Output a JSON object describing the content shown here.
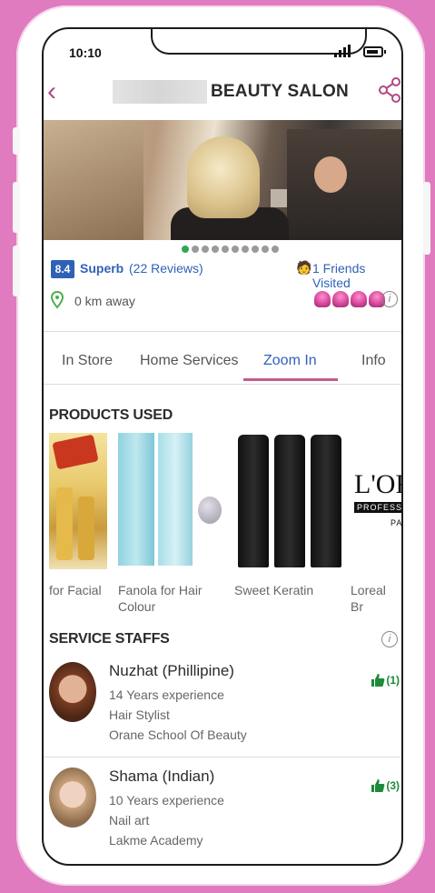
{
  "status_bar": {
    "time": "10:10"
  },
  "header": {
    "title": "BEAUTY SALON"
  },
  "rating": {
    "score": "8.4",
    "label": "Superb",
    "reviews": "(22 Reviews)",
    "friends": "1 Friends Visited"
  },
  "location": {
    "distance": "0 km away",
    "cupcake_rating": 4
  },
  "tabs": [
    {
      "label": "In Store",
      "active": false
    },
    {
      "label": "Home Services",
      "active": false
    },
    {
      "label": "Zoom In",
      "active": true
    },
    {
      "label": "Info",
      "active": false
    }
  ],
  "products_section": {
    "title": "PRODUCTS USED",
    "items": [
      {
        "caption": "for Facial"
      },
      {
        "caption": "Fanola for Hair\nColour"
      },
      {
        "caption": "Sweet Keratin"
      },
      {
        "caption": "Loreal Br"
      }
    ],
    "brand_text": {
      "line1": "L'OR",
      "line2": "PROFESS",
      "line3": "PA"
    }
  },
  "staff_section": {
    "title": "SERVICE STAFFS",
    "staff": [
      {
        "name": "Nuzhat  (Phillipine)",
        "experience": "14 Years experience",
        "role": "Hair Stylist",
        "school": "Orane School Of Beauty",
        "likes": "(1)"
      },
      {
        "name": "Shama  (Indian)",
        "experience": "10 Years experience",
        "role": "Nail art",
        "school": "Lakme Academy",
        "likes": "(3)"
      }
    ]
  },
  "colors": {
    "accent": "#2f62b6",
    "brand_pink": "#c25b8d",
    "background": "#e07bbf",
    "like_green": "#1e8a3a"
  }
}
